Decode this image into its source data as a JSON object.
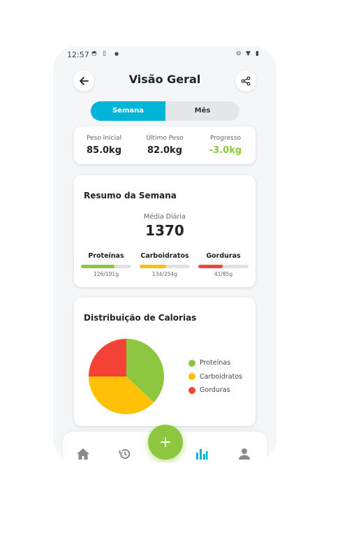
{
  "status": {
    "time": "12:57"
  },
  "header": {
    "title": "Visão Geral"
  },
  "segmented": {
    "week_label": "Semana",
    "month_label": "Mês",
    "active": "week"
  },
  "progress": {
    "initial_label": "Peso Inicial",
    "initial_value": "85.0kg",
    "last_label": "Último Peso",
    "last_value": "82.0kg",
    "progress_label": "Progresso",
    "progress_value": "-3.0kg"
  },
  "summary": {
    "title": "Resumo da Semana",
    "avg_label": "Média Diária",
    "avg_value": "1370",
    "macros": [
      {
        "name": "Proteínas",
        "amount": "126/191g",
        "fraction": 0.66,
        "color": "#8dc63f"
      },
      {
        "name": "Carboidratos",
        "amount": "134/254g",
        "fraction": 0.53,
        "color": "#ffc107"
      },
      {
        "name": "Gorduras",
        "amount": "41/85g",
        "fraction": 0.48,
        "color": "#f44336"
      }
    ]
  },
  "distribution": {
    "title": "Distribuição de Calorias",
    "legend": [
      {
        "label": "Proteínas",
        "color": "#8dc63f"
      },
      {
        "label": "Carboidratos",
        "color": "#ffc107"
      },
      {
        "label": "Gorduras",
        "color": "#f44336"
      }
    ]
  },
  "chart_data": {
    "type": "pie",
    "title": "Distribuição de Calorias",
    "slices": [
      {
        "label": "Proteínas",
        "value": 37,
        "color": "#8dc63f"
      },
      {
        "label": "Carboidratos",
        "value": 38,
        "color": "#ffc107"
      },
      {
        "label": "Gorduras",
        "value": 25,
        "color": "#f44336"
      }
    ],
    "legend_position": "right"
  },
  "nav": {
    "items": [
      {
        "icon": "home-icon"
      },
      {
        "icon": "history-icon"
      },
      {
        "icon": "stats-icon",
        "active": true
      },
      {
        "icon": "profile-icon"
      }
    ],
    "fab_icon": "plus-icon",
    "active_color": "#00b4d8"
  },
  "colors": {
    "accent": "#00b4d8",
    "green": "#8dc63f",
    "yellow": "#ffc107",
    "red": "#f44336"
  }
}
